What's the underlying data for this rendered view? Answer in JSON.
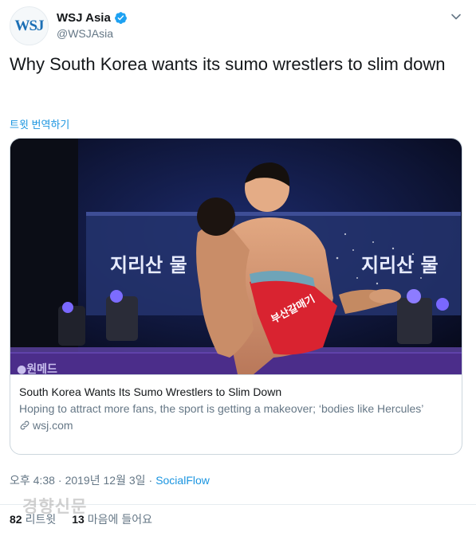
{
  "account": {
    "avatar_text": "WSJ",
    "display_name": "WSJ Asia",
    "handle": "@WSJAsia"
  },
  "tweet": {
    "text": "Why South Korea wants its sumo wrestlers to slim down",
    "translate_label": "트윗 번역하기"
  },
  "card": {
    "image_signs": {
      "left_sign": "지리산 물",
      "right_sign": "지리산 물",
      "trunks_text": "부산갈매기",
      "banner_text": "●원메드"
    },
    "title": "South Korea Wants Its Sumo Wrestlers to Slim Down",
    "description": "Hoping to attract more fans, the sport is getting a makeover; ‘bodies like Hercules’",
    "domain": "wsj.com"
  },
  "meta": {
    "time": "오후 4:38",
    "date": "2019년 12월 3일",
    "source": "SocialFlow",
    "separator": "·"
  },
  "watermark": "경향신문",
  "stats": {
    "retweets_count": "82",
    "retweets_label": "리트윗",
    "likes_count": "13",
    "likes_label": "마음에 들어요"
  },
  "colors": {
    "accent": "#1b95e0",
    "verified": "#1da1f2",
    "muted": "#657786"
  }
}
